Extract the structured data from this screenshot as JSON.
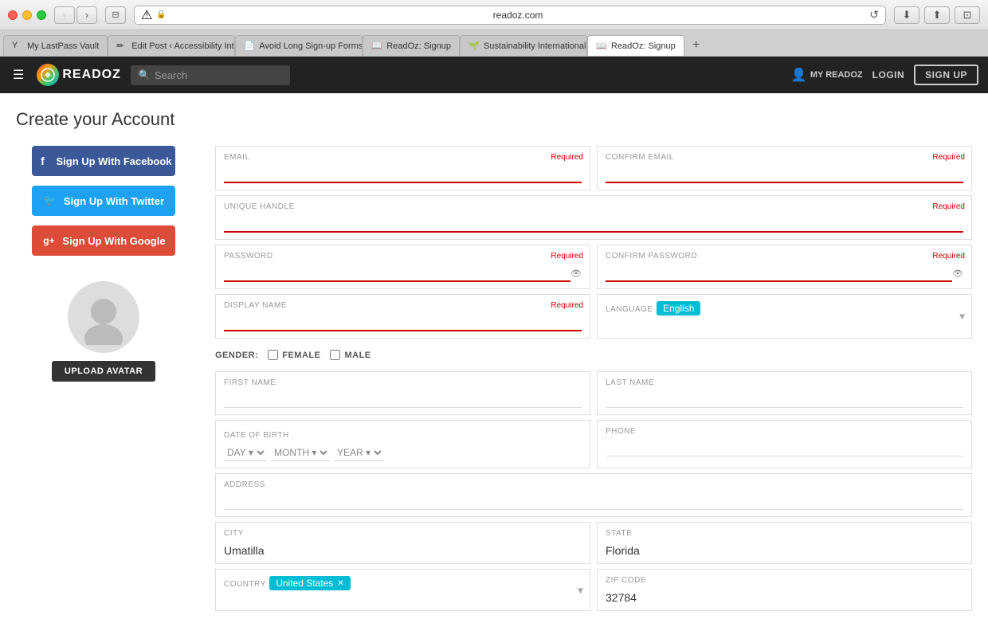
{
  "window": {
    "address": "readoz.com",
    "address_lock": "🔒",
    "warning_icon": "⚠"
  },
  "tabs": [
    {
      "id": "lastpass",
      "label": "My LastPass Vault",
      "favicon": "🔐",
      "active": false
    },
    {
      "id": "edit-post",
      "label": "Edit Post ‹ Accessibility Int...",
      "favicon": "✏",
      "active": false
    },
    {
      "id": "avoid",
      "label": "Avoid Long Sign-up Forms...",
      "favicon": "📄",
      "active": false
    },
    {
      "id": "readoz-signup1",
      "label": "ReadOz: Signup",
      "favicon": "📖",
      "active": false
    },
    {
      "id": "sustainability",
      "label": "Sustainability International",
      "favicon": "🌱",
      "active": false
    },
    {
      "id": "readoz-signup2",
      "label": "ReadOz: Signup",
      "favicon": "📖",
      "active": true
    }
  ],
  "navbar": {
    "logo_text": "READOZ",
    "search_placeholder": "Search",
    "my_readoz_label": "MY READOZ",
    "login_label": "LOGIN",
    "signup_label": "SIGN UP",
    "hamburger": "☰"
  },
  "page": {
    "title": "Create your Account"
  },
  "social_buttons": {
    "facebook_label": "Sign Up With Facebook",
    "twitter_label": "Sign Up With Twitter",
    "google_label": "Sign Up With Google"
  },
  "avatar": {
    "upload_label": "UPLOAD AVATAR"
  },
  "form": {
    "email_label": "EMAIL",
    "email_required": "Required",
    "confirm_email_label": "CONFIRM EMAIL",
    "confirm_email_required": "Required",
    "unique_handle_label": "UNIQUE HANDLE",
    "unique_handle_required": "Required",
    "password_label": "PASSWORD",
    "password_required": "Required",
    "confirm_password_label": "CONFIRM PASSWORD",
    "confirm_password_required": "Required",
    "display_name_label": "DISPLAY NAME",
    "display_name_required": "Required",
    "language_label": "LANGUAGE",
    "language_value": "English",
    "gender_label": "GENDER:",
    "female_label": "FEMALE",
    "male_label": "MALE",
    "first_name_label": "FIRST NAME",
    "last_name_label": "LAST NAME",
    "dob_label": "DATE OF BIRTH",
    "dob_day": "DAY",
    "dob_month": "MONTH",
    "dob_year": "YEAR",
    "phone_label": "PHONE",
    "address_label": "ADDRESS",
    "city_label": "CITY",
    "city_value": "Umatilla",
    "state_label": "STATE",
    "state_value": "Florida",
    "country_label": "COUNTRY",
    "country_value": "United States",
    "zip_label": "ZIP CODE",
    "zip_value": "32784"
  }
}
